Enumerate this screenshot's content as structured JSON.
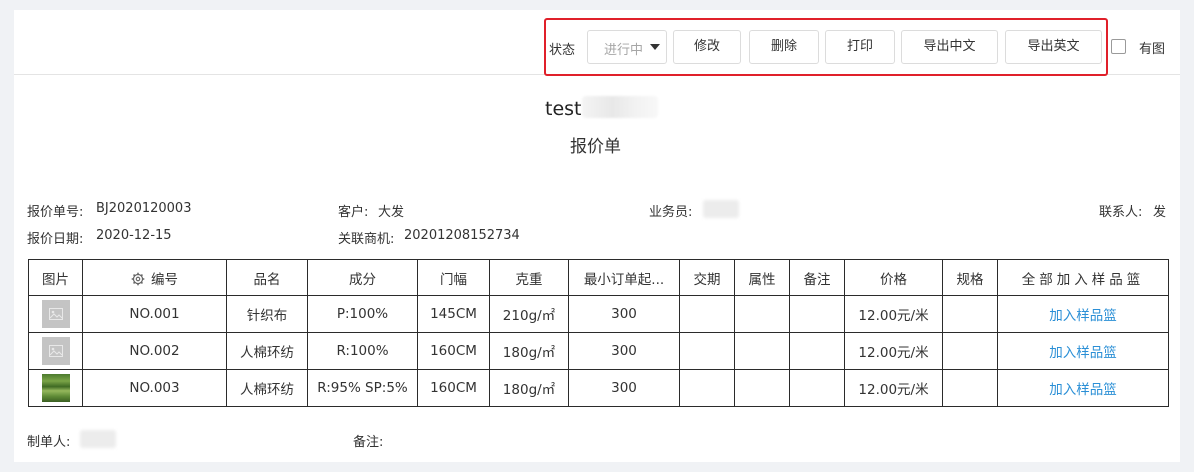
{
  "toolbar": {
    "status_label": "状态",
    "status_value": "进行中",
    "buttons": [
      "修改",
      "删除",
      "打印",
      "导出中文",
      "导出英文"
    ],
    "with_image_label": "有图"
  },
  "header": {
    "company_name": "test",
    "doc_title": "报价单"
  },
  "info": {
    "quote_no_label": "报价单号:",
    "quote_no": "BJ2020120003",
    "customer_label": "客户:",
    "customer": "大发",
    "salesman_label": "业务员:",
    "contact_label": "联系人:",
    "contact": "发",
    "quote_date_label": "报价日期:",
    "quote_date": "2020-12-15",
    "related_label": "关联商机:",
    "related": "20201208152734"
  },
  "table": {
    "headers": {
      "image": "图片",
      "code": "编号",
      "name": "品名",
      "composition": "成分",
      "width": "门幅",
      "weight": "克重",
      "moq": "最小订单起...",
      "delivery": "交期",
      "attribute": "属性",
      "remark": "备注",
      "price": "价格",
      "spec": "规格",
      "add_all": "全部加入样品篮"
    },
    "rows": [
      {
        "code": "NO.001",
        "name": "针织布",
        "composition": "P:100%",
        "width": "145CM",
        "weight": "210g/㎡",
        "moq": "300",
        "delivery": "",
        "attribute": "",
        "remark": "",
        "price": "12.00元/米",
        "spec": "",
        "action": "加入样品篮"
      },
      {
        "code": "NO.002",
        "name": "人棉环纺",
        "composition": "R:100%",
        "width": "160CM",
        "weight": "180g/㎡",
        "moq": "300",
        "delivery": "",
        "attribute": "",
        "remark": "",
        "price": "12.00元/米",
        "spec": "",
        "action": "加入样品篮"
      },
      {
        "code": "NO.003",
        "name": "人棉环纺",
        "composition": "R:95% SP:5%",
        "width": "160CM",
        "weight": "180g/㎡",
        "moq": "300",
        "delivery": "",
        "attribute": "",
        "remark": "",
        "price": "12.00元/米",
        "spec": "",
        "action": "加入样品篮"
      }
    ]
  },
  "footer": {
    "creator_label": "制单人:",
    "remark_label": "备注:"
  }
}
